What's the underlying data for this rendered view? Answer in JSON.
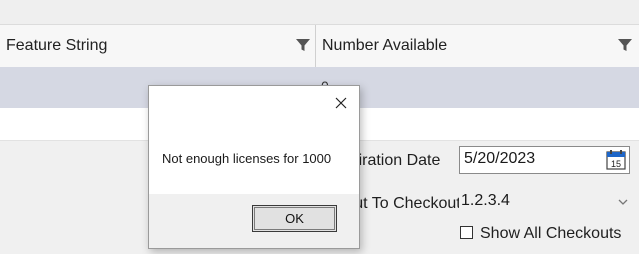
{
  "grid": {
    "columns": [
      {
        "label": "Feature String",
        "filter_icon": "filter-icon"
      },
      {
        "label": "Number Available",
        "filter_icon": "filter-icon"
      }
    ],
    "selected_row": {
      "number_available": "0"
    }
  },
  "form": {
    "expiration_label": "Expiration Date",
    "expiration_value": "5/20/2023",
    "calendar_day": "15",
    "checkout_label": "Checkout To Checkout",
    "checkout_value": "1.2.3.4",
    "show_all_label": "Show All Checkouts",
    "show_all_checked": false
  },
  "dialog": {
    "message": "Not enough licenses for 1000",
    "ok_label": "OK",
    "close_icon": "close-icon"
  },
  "colors": {
    "selected_row": "#d5d8e3",
    "calendar_accent": "#1e66c8"
  }
}
